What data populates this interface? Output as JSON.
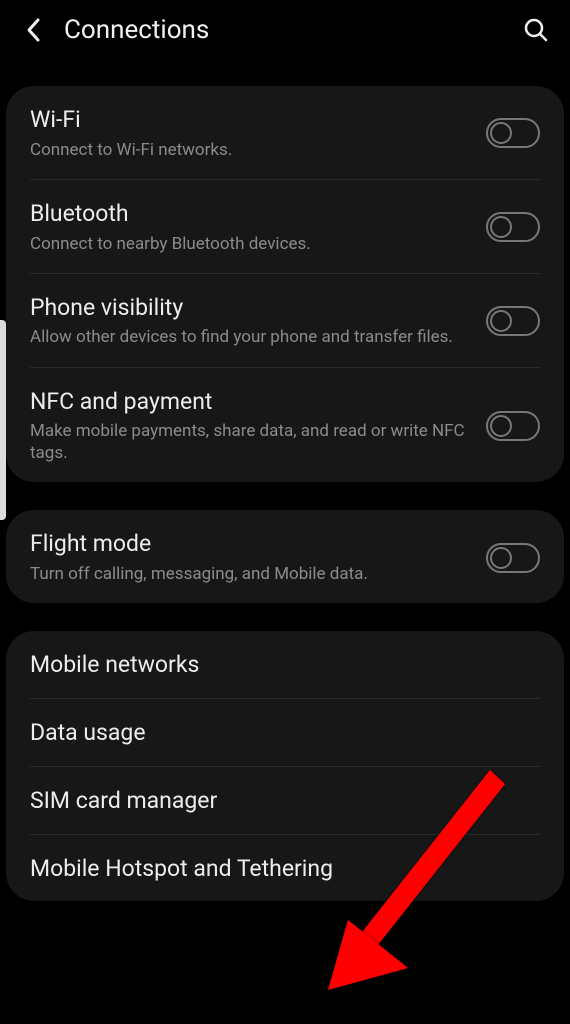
{
  "header": {
    "title": "Connections"
  },
  "cards": [
    {
      "rows": [
        {
          "title": "Wi-Fi",
          "sub": "Connect to Wi-Fi networks.",
          "toggle": true
        },
        {
          "title": "Bluetooth",
          "sub": "Connect to nearby Bluetooth devices.",
          "toggle": true
        },
        {
          "title": "Phone visibility",
          "sub": "Allow other devices to find your phone and transfer files.",
          "toggle": true
        },
        {
          "title": "NFC and payment",
          "sub": "Make mobile payments, share data, and read or write NFC tags.",
          "toggle": true
        }
      ]
    },
    {
      "rows": [
        {
          "title": "Flight mode",
          "sub": "Turn off calling, messaging, and Mobile data.",
          "toggle": true
        }
      ]
    },
    {
      "rows": [
        {
          "title": "Mobile networks",
          "sub": "",
          "toggle": false
        },
        {
          "title": "Data usage",
          "sub": "",
          "toggle": false
        },
        {
          "title": "SIM card manager",
          "sub": "",
          "toggle": false
        },
        {
          "title": "Mobile Hotspot and Tethering",
          "sub": "",
          "toggle": false
        }
      ]
    }
  ],
  "annotation": {
    "arrow_color": "#ff0000"
  }
}
